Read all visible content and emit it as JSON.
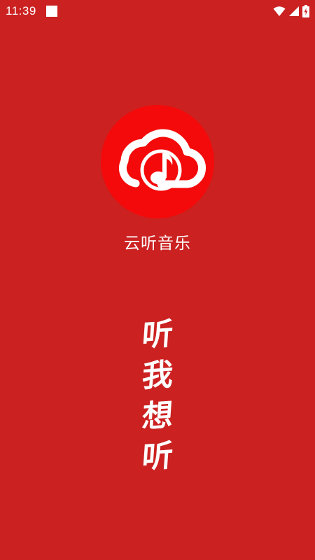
{
  "status_bar": {
    "time": "11:39",
    "icons": [
      "notification-square-icon",
      "wifi-icon",
      "cellular-signal-icon",
      "battery-charging-icon"
    ]
  },
  "splash": {
    "app_name": "云听音乐",
    "slogan": [
      "听",
      "我",
      "想",
      "听"
    ],
    "logo_icon": "cloud-music-note-icon"
  },
  "colors": {
    "background": "#cb2121",
    "logo_circle": "#f40a0a",
    "foreground": "#ffffff"
  }
}
